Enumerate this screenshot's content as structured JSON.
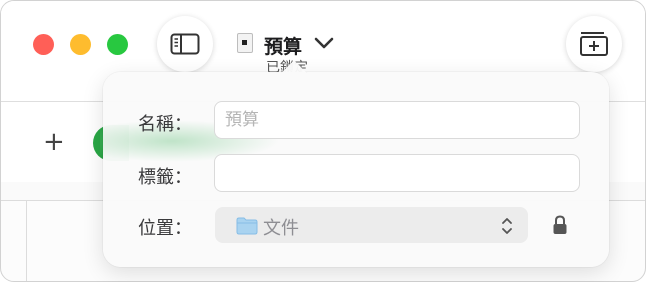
{
  "window": {
    "controls": [
      "close",
      "minimize",
      "maximize"
    ],
    "colors": {
      "close": "#ff5f57",
      "minimize": "#febc2e",
      "maximize": "#28c840"
    }
  },
  "toolbar": {
    "sidebar_icon": "sidebar-icon",
    "add_icon": "add-frame-icon"
  },
  "document": {
    "icon": "document-icon",
    "title": "預算",
    "subtitle": "已鎖定"
  },
  "secondary_toolbar": {
    "plus_label": "+"
  },
  "popover": {
    "name_label": "名稱：",
    "name_placeholder": "預算",
    "tags_label": "標籤：",
    "tags_value": "",
    "location_label": "位置：",
    "location_value": "文件",
    "location_icon": "folder-icon",
    "lock_icon": "lock-icon"
  }
}
